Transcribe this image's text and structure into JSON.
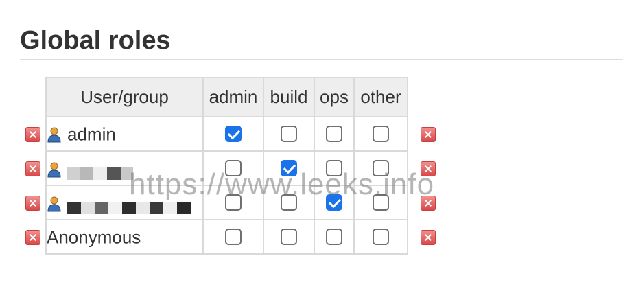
{
  "page": {
    "title": "Global roles"
  },
  "table": {
    "headers": [
      "User/group",
      "admin",
      "build",
      "ops",
      "other"
    ],
    "rows": [
      {
        "name": "admin",
        "user_icon": "user-icon",
        "checks": [
          true,
          false,
          false,
          false
        ]
      },
      {
        "name": "",
        "user_icon": "user-icon",
        "redacted": true,
        "checks": [
          false,
          true,
          false,
          false
        ]
      },
      {
        "name": "",
        "user_icon": "user-icon",
        "redacted": true,
        "checks": [
          false,
          false,
          true,
          false
        ]
      },
      {
        "name": "Anonymous",
        "user_icon": null,
        "checks": [
          false,
          false,
          false,
          false
        ]
      }
    ]
  },
  "watermark": "https://www.leeks.info",
  "colors": {
    "checked": "#1a73e8",
    "delete": "#d94848",
    "header_bg": "#eeeeee"
  }
}
